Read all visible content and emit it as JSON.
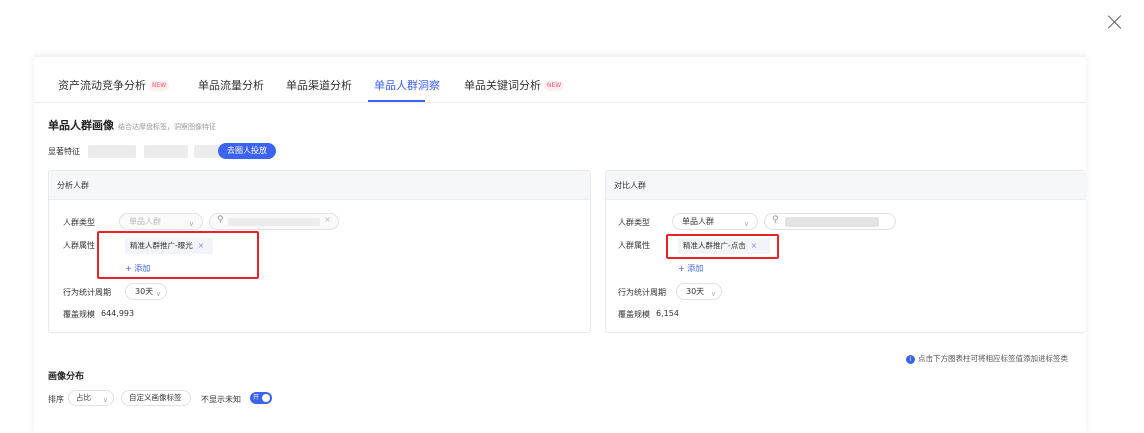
{
  "tabs": [
    {
      "label": "资产流动竞争分析",
      "badge": "NEW"
    },
    {
      "label": "单品流量分析"
    },
    {
      "label": "单品渠道分析"
    },
    {
      "label": "单品人群洞察",
      "active": true
    },
    {
      "label": "单品关键词分析",
      "badge": "NEW"
    }
  ],
  "portrait": {
    "title": "单品人群画像",
    "subtitle": "结合达摩盘标签，洞察图像特征",
    "feature_label": "显著特征",
    "launch_button": "去圈人投放"
  },
  "analysis_card": {
    "title": "分析人群",
    "type_label": "人群类型",
    "type_value": "单品人群",
    "attr_label": "人群属性",
    "tag": "精准人群推广-曝光",
    "add_label": "+ 添加",
    "period_label": "行为统计周期",
    "period_value": "30天",
    "coverage_label": "覆盖规模",
    "coverage_value": "644,993"
  },
  "compare_card": {
    "title": "对比人群",
    "type_label": "人群类型",
    "type_value": "单品人群",
    "attr_label": "人群属性",
    "tag": "精准人群推广-点击",
    "add_label": "+ 添加",
    "period_label": "行为统计周期",
    "period_value": "30天",
    "coverage_label": "覆盖规模",
    "coverage_value": "6,154"
  },
  "info_note": "点击下方图表柱可将相应标签值添加进标签类",
  "distribution": {
    "title": "画像分布",
    "sort_label": "排序",
    "sort_value": "占比",
    "custom_button": "自定义画像标签",
    "hide_unknown_label": "不显示未知",
    "toggle_label": "开"
  },
  "colors": {
    "accent": "#3d63f4",
    "highlight_box": "#e8222a",
    "new_badge": "#ff5a6e"
  },
  "icons": {
    "close": "close-icon",
    "search": "search-icon",
    "info": "info-icon",
    "chevron": "chevron-down-icon"
  }
}
